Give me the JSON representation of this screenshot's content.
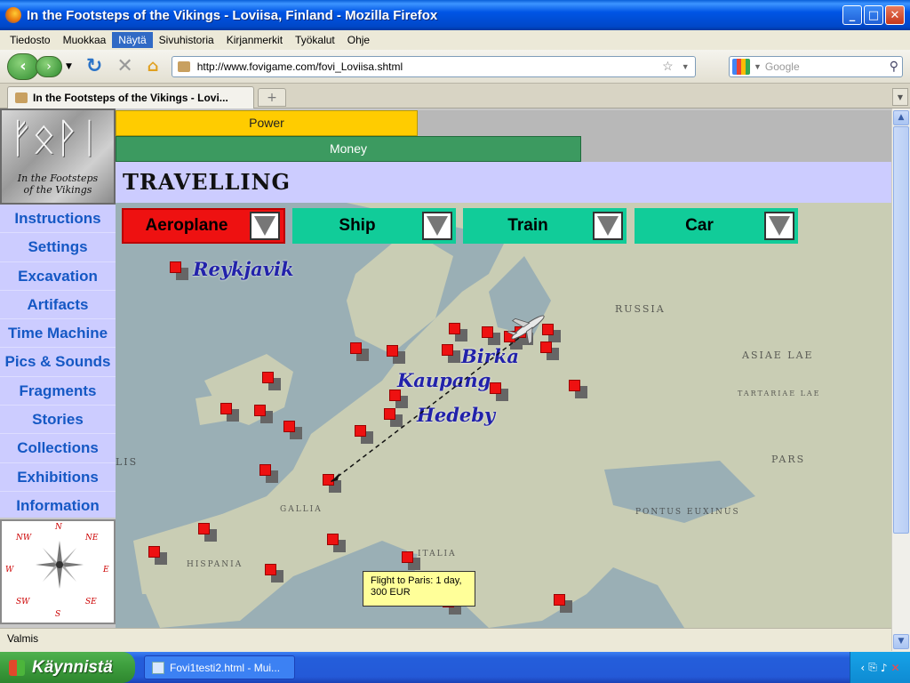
{
  "window": {
    "title": "In the Footsteps of the Vikings - Loviisa, Finland - Mozilla Firefox"
  },
  "menu": [
    "Tiedosto",
    "Muokkaa",
    "Näytä",
    "Sivuhistoria",
    "Kirjanmerkit",
    "Työkalut",
    "Ohje"
  ],
  "menu_active_index": 2,
  "navbar": {
    "url": "http://www.fovigame.com/fovi_Loviisa.shtml",
    "search_placeholder": "Google"
  },
  "tab": {
    "title": "In the Footsteps of the Vikings - Lovi..."
  },
  "game": {
    "logo_caption_line1": "In the Footsteps",
    "logo_caption_line2": "of the Vikings",
    "power_label": "Power",
    "power_level": 0.39,
    "money_label": "Money",
    "money_level": 0.6,
    "heading": "TRAVELLING",
    "side_menu": [
      "Instructions",
      "Settings",
      "Excavation",
      "Artifacts",
      "Time Machine",
      "Pics & Sounds",
      "Fragments",
      "Stories",
      "Collections",
      "Exhibitions",
      "Information"
    ],
    "transport": [
      {
        "label": "Aeroplane",
        "color": "#EE1111",
        "selected": true
      },
      {
        "label": "Ship",
        "color": "#11CC99",
        "selected": false
      },
      {
        "label": "Train",
        "color": "#11CC99",
        "selected": false
      },
      {
        "label": "Car",
        "color": "#11CC99",
        "selected": false
      }
    ],
    "cities": [
      "Reykjavik",
      "Birka",
      "Kaupang",
      "Hedeby"
    ],
    "tooltip": "Flight to Paris: 1 day, 300 EUR",
    "compass": {
      "n": "N",
      "ne": "NE",
      "e": "E",
      "se": "SE",
      "s": "S",
      "sw": "SW",
      "w": "W",
      "nw": "NW"
    },
    "regions": [
      "RUSSIA",
      "ASIAE LAE",
      "PARS",
      "LIS",
      "TARTARIAE LAE",
      "PONTUS EUXINUS",
      "HISPANIA",
      "GALLIA",
      "ITALIA"
    ]
  },
  "status": "Valmis",
  "taskbar": {
    "start": "Käynnistä",
    "task": "Fovi1testi2.html - Mui..."
  }
}
